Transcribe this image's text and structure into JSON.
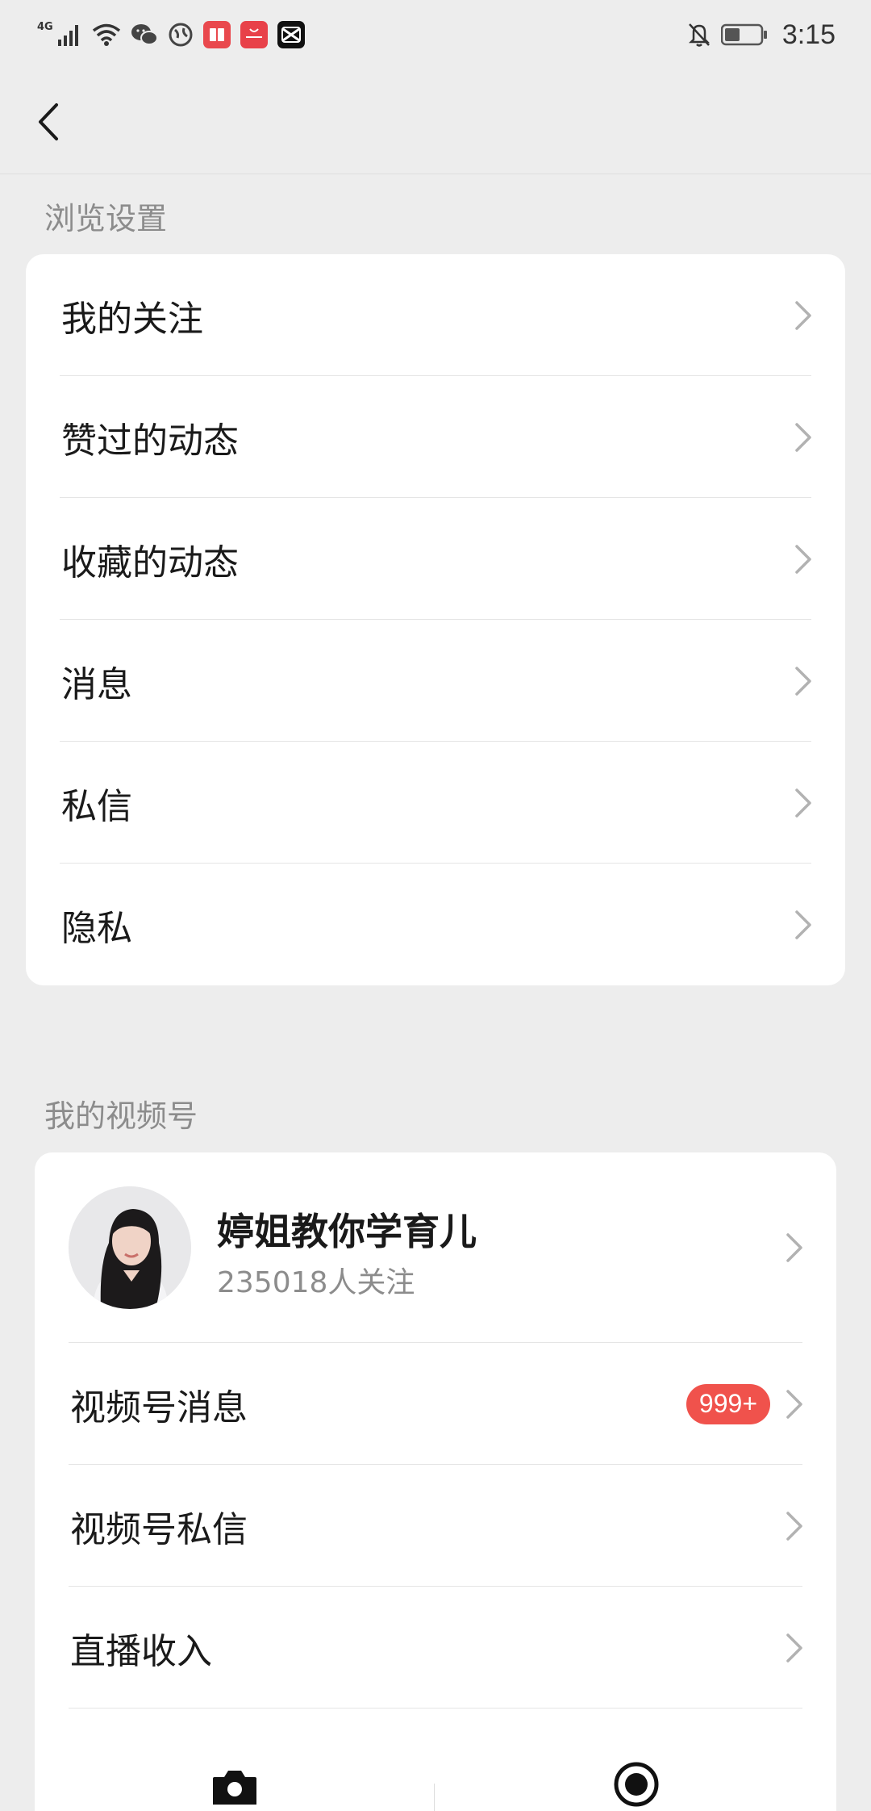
{
  "status_bar": {
    "network_label": "4G",
    "time": "3:15",
    "icons": [
      "signal-icon",
      "wifi-icon",
      "wechat-icon",
      "browser-icon",
      "reader-app-icon",
      "huawei-appgallery-icon",
      "capcut-icon",
      "mute-bell-icon",
      "battery-icon"
    ]
  },
  "browse_section": {
    "title": "浏览设置",
    "items": [
      {
        "label": "我的关注"
      },
      {
        "label": "赞过的动态"
      },
      {
        "label": "收藏的动态"
      },
      {
        "label": "消息"
      },
      {
        "label": "私信"
      },
      {
        "label": "隐私"
      }
    ]
  },
  "channel_section": {
    "title": "我的视频号",
    "profile": {
      "name": "婷姐教你学育儿",
      "followers": "235018人关注"
    },
    "items": [
      {
        "label": "视频号消息",
        "badge": "999+"
      },
      {
        "label": "视频号私信"
      },
      {
        "label": "直播收入"
      }
    ]
  },
  "colors": {
    "background": "#ededed",
    "card": "#ffffff",
    "badge": "#f0524c",
    "secondary_text": "#8c8c8c"
  },
  "bottom_actions": {
    "icons": [
      "camera-icon",
      "live-record-icon"
    ]
  }
}
